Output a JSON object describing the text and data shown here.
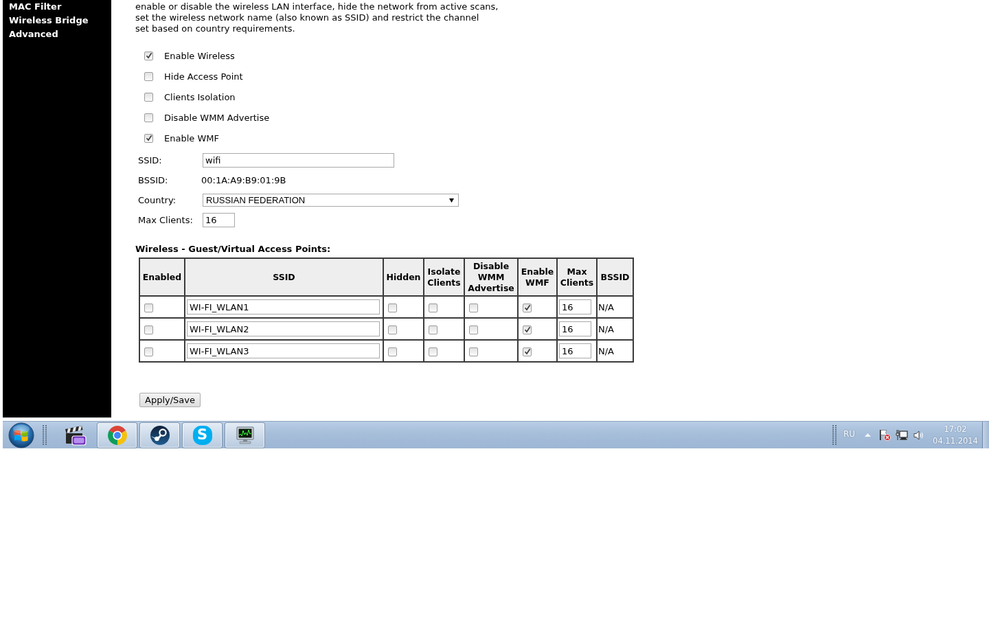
{
  "sidebar": {
    "items": [
      "MAC Filter",
      "Wireless Bridge",
      "Advanced"
    ]
  },
  "description": "enable or disable the wireless LAN interface, hide the network from active scans,\nset the wireless network name (also known as SSID) and restrict the channel\nset based on country requirements.",
  "options": [
    {
      "label": "Enable Wireless",
      "checked": true
    },
    {
      "label": "Hide Access Point",
      "checked": false
    },
    {
      "label": "Clients Isolation",
      "checked": false
    },
    {
      "label": "Disable WMM Advertise",
      "checked": false
    },
    {
      "label": "Enable WMF",
      "checked": true
    }
  ],
  "fields": [
    {
      "kind": "text",
      "label": "SSID:",
      "value": "wifi"
    },
    {
      "kind": "static",
      "label": "BSSID:",
      "value": "00:1A:A9:B9:01:9B"
    },
    {
      "kind": "select",
      "label": "Country:",
      "value": "RUSSIAN FEDERATION"
    },
    {
      "kind": "number",
      "label": "Max Clients:",
      "value": "16"
    }
  ],
  "guest_access_points": {
    "title": "Wireless - Guest/Virtual Access Points:",
    "columns": [
      "Enabled",
      "SSID",
      "Hidden",
      "Isolate Clients",
      "Disable WMM Advertise",
      "Enable WMF",
      "Max Clients",
      "BSSID"
    ],
    "rows": [
      {
        "enabled": false,
        "ssid": "WI-FI_WLAN1",
        "hidden": false,
        "isolate_clients": false,
        "disable_wmm_advertise": false,
        "enable_wmf": true,
        "max_clients": "16",
        "bssid": "N/A"
      },
      {
        "enabled": false,
        "ssid": "WI-FI_WLAN2",
        "hidden": false,
        "isolate_clients": false,
        "disable_wmm_advertise": false,
        "enable_wmf": true,
        "max_clients": "16",
        "bssid": "N/A"
      },
      {
        "enabled": false,
        "ssid": "WI-FI_WLAN3",
        "hidden": false,
        "isolate_clients": false,
        "disable_wmm_advertise": false,
        "enable_wmf": true,
        "max_clients": "16",
        "bssid": "N/A"
      }
    ]
  },
  "buttons": [
    "Apply/Save"
  ],
  "taskbar": {
    "apps": [
      {
        "kind": "video",
        "running": false
      },
      {
        "kind": "browser",
        "running": true
      },
      {
        "kind": "game",
        "running": true
      },
      {
        "kind": "messenger",
        "letter": "S",
        "running": true
      },
      {
        "kind": "monitor",
        "running": true
      }
    ],
    "language": "RU",
    "time": "17:02",
    "date": "04.11.2014"
  }
}
